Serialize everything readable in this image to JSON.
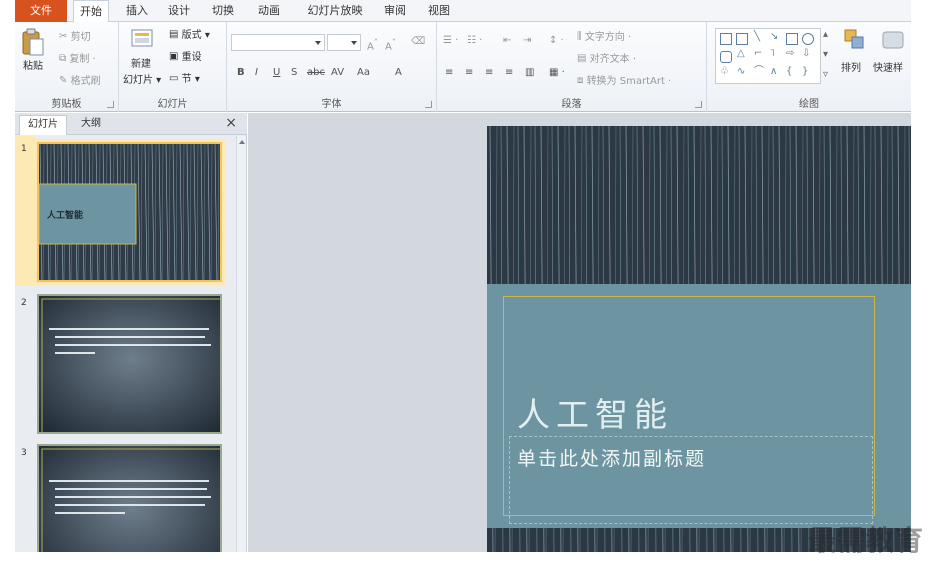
{
  "ribbon_tabs": [
    "文件",
    "开始",
    "插入",
    "设计",
    "切换",
    "动画",
    "幻灯片放映",
    "审阅",
    "视图"
  ],
  "groups": {
    "clipboard": {
      "label": "剪贴板",
      "paste": "粘贴",
      "cut": "剪切",
      "copy": "复制",
      "format_painter": "格式刷"
    },
    "slides": {
      "label": "幻灯片",
      "new_slide_1": "新建",
      "new_slide_2": "幻灯片",
      "layout": "版式",
      "reset": "重设",
      "section": "节"
    },
    "font": {
      "label": "字体",
      "bold": "B",
      "italic": "I",
      "underline": "U",
      "shadow": "S",
      "strike": "abc",
      "spacing": "AV",
      "case": "Aa",
      "color": "A",
      "grow": "A",
      "shrink": "A"
    },
    "paragraph": {
      "label": "段落",
      "text_direction": "文字方向",
      "align_text": "对齐文本",
      "smartart": "转换为 SmartArt"
    },
    "drawing": {
      "label": "绘图",
      "arrange": "排列",
      "quick_styles": "快速样"
    }
  },
  "panel": {
    "tab_slides": "幻灯片",
    "tab_outline": "大纲",
    "close": "×"
  },
  "thumbnails": [
    {
      "num": "1",
      "title": "人工智能"
    },
    {
      "num": "2"
    },
    {
      "num": "3"
    }
  ],
  "slide": {
    "title": "人工智能",
    "subtitle": "单击此处添加副标题"
  },
  "watermark": "最需教育",
  "colors": {
    "file_tab": "#d8521d",
    "slide_bg": "#2c3844",
    "title_box": "#6d95a1",
    "frame_gold": "#c9b94a"
  }
}
